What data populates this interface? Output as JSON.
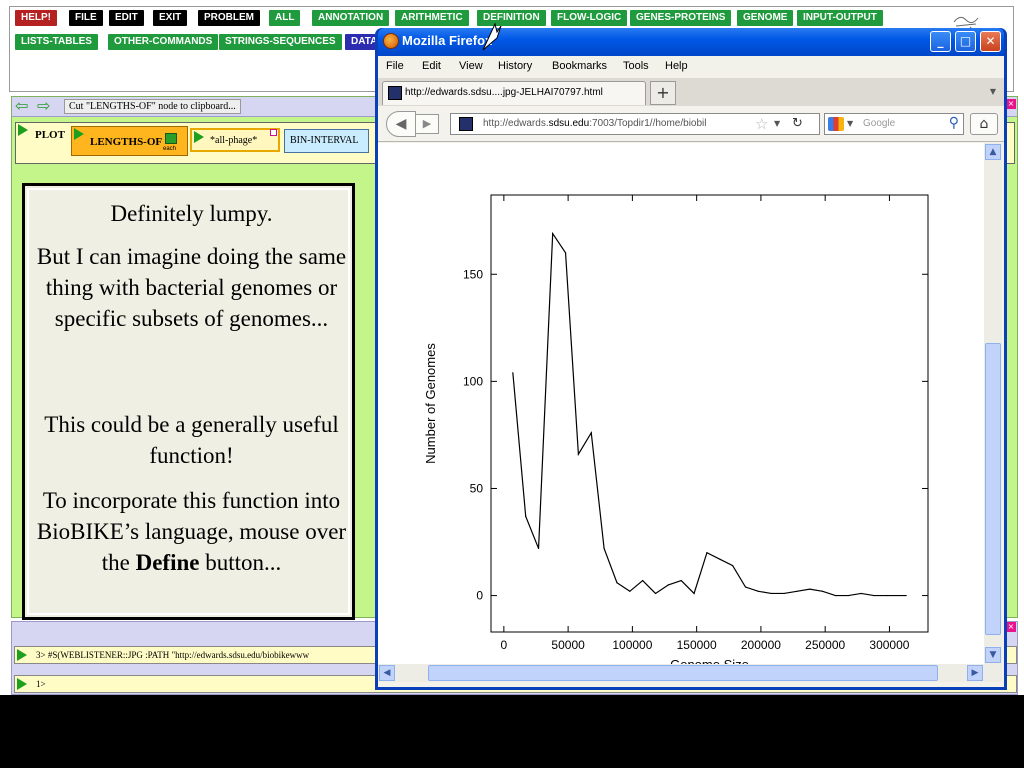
{
  "toolbar": {
    "row1": [
      {
        "label": "HELP!",
        "color": "red"
      },
      {
        "label": "FILE",
        "color": "black"
      },
      {
        "label": "EDIT",
        "color": "black"
      },
      {
        "label": "EXIT",
        "color": "black"
      },
      {
        "label": "PROBLEM",
        "color": "black"
      },
      {
        "label": "ALL",
        "color": "green"
      },
      {
        "label": "ANNOTATION",
        "color": "green"
      },
      {
        "label": "ARITHMETIC",
        "color": "green"
      },
      {
        "label": "DEFINITION",
        "color": "green"
      },
      {
        "label": "FLOW-LOGIC",
        "color": "green"
      },
      {
        "label": "GENES-PROTEINS",
        "color": "green"
      },
      {
        "label": "GENOME",
        "color": "green"
      },
      {
        "label": "INPUT-OUTPUT",
        "color": "green"
      }
    ],
    "row2": [
      {
        "label": "LISTS-TABLES",
        "color": "green"
      },
      {
        "label": "OTHER-COMMANDS",
        "color": "green"
      },
      {
        "label": "STRINGS-SEQUENCES",
        "color": "green"
      },
      {
        "label": "DATA",
        "color": "blue"
      }
    ]
  },
  "workspace": {
    "status_message": "Cut \"LENGTHS-OF\" node to clipboard...",
    "plot_label": "PLOT",
    "lengths_label": "LENGTHS-OF",
    "each_label": "each",
    "phage_label": "*all-phage*",
    "bin_label": "BIN-INTERVAL"
  },
  "note": {
    "p1": "Definitely lumpy.",
    "p2": "But I can imagine doing the same thing with bacterial genomes or specific subsets of genomes...",
    "p3": "This could be a generally useful function!",
    "p4_pre": "To incorporate this function into BioBIKE’s language, mouse over the ",
    "p4_bold": "Define",
    "p4_post": " button..."
  },
  "listener": {
    "line1": "3> #S(WEBLISTENER::JPG :PATH \"http://edwards.sdsu.edu/biobikewww",
    "line2": "1>"
  },
  "browser": {
    "title": "Mozilla Firefox",
    "menus": [
      "File",
      "Edit",
      "View",
      "History",
      "Bookmarks",
      "Tools",
      "Help"
    ],
    "tab_title": "http://edwards.sdsu....jpg-JELHAI70797.html",
    "url_prefix": "http://edwards.",
    "url_host": "sdsu.edu",
    "url_suffix": ":7003/Topdir1//home/biobil",
    "search_placeholder": "Google"
  },
  "chart_data": {
    "type": "line",
    "xlabel": "Genome Size",
    "ylabel": "Number of Genomes",
    "xlim": [
      -10000,
      330000
    ],
    "ylim": [
      -17,
      187
    ],
    "xticks": [
      0,
      50000,
      100000,
      150000,
      200000,
      250000,
      300000
    ],
    "yticks": [
      0,
      50,
      100,
      150
    ],
    "x": [
      7000,
      17000,
      27000,
      38000,
      48000,
      58000,
      68000,
      78000,
      88000,
      98000,
      108000,
      118000,
      128000,
      138000,
      148000,
      158000,
      168000,
      178000,
      188000,
      198000,
      208000,
      218000,
      228000,
      238000,
      248000,
      258000,
      268000,
      278000,
      288000,
      298000,
      313000
    ],
    "values": [
      104,
      37,
      22,
      169,
      160,
      66,
      76,
      22,
      6,
      2,
      7,
      1,
      5,
      7,
      1,
      20,
      17,
      14,
      4,
      2,
      1,
      1,
      2,
      3,
      2,
      0,
      0,
      1,
      0,
      0,
      0
    ]
  }
}
